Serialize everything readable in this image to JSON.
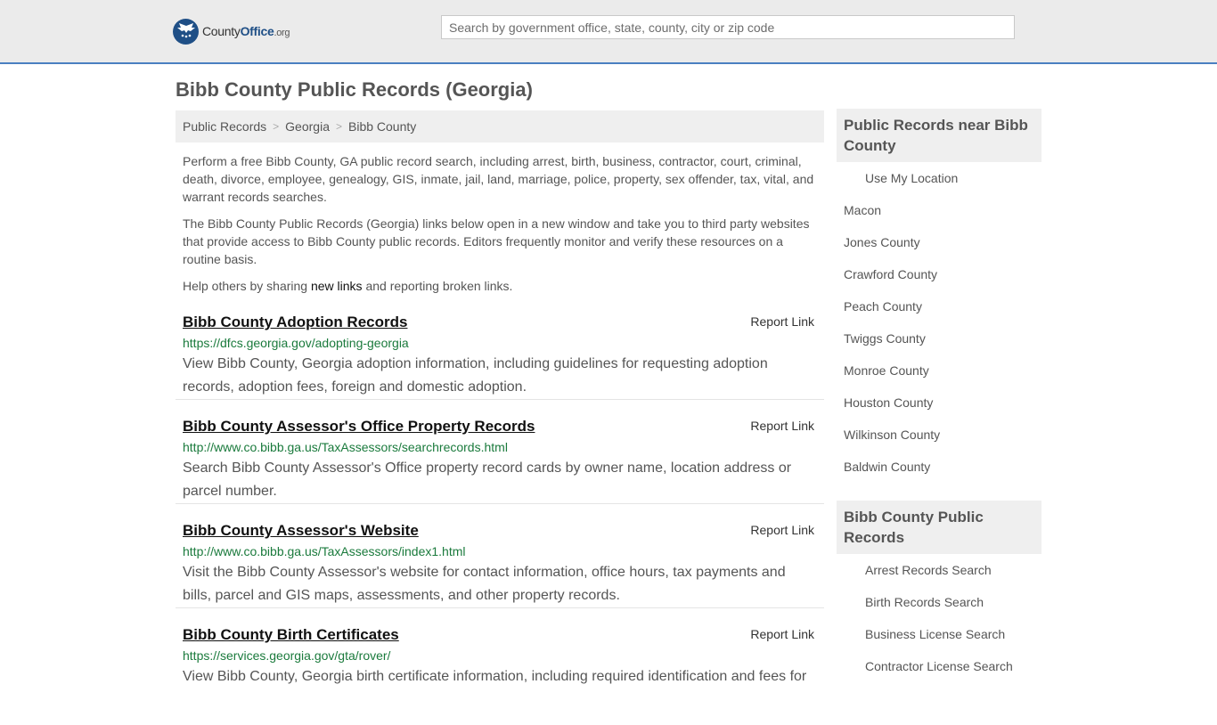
{
  "header": {
    "logo": {
      "county": "County",
      "office": "Office",
      "tld": ".org"
    },
    "search_placeholder": "Search by government office, state, county, city or zip code"
  },
  "page_title": "Bibb County Public Records (Georgia)",
  "breadcrumb": [
    "Public Records",
    "Georgia",
    "Bibb County"
  ],
  "intro": {
    "p1": "Perform a free Bibb County, GA public record search, including arrest, birth, business, contractor, court, criminal, death, divorce, employee, genealogy, GIS, inmate, jail, land, marriage, police, property, sex offender, tax, vital, and warrant records searches.",
    "p2": "The Bibb County Public Records (Georgia) links below open in a new window and take you to third party websites that provide access to Bibb County public records. Editors frequently monitor and verify these resources on a routine basis.",
    "p3_before": "Help others by sharing ",
    "p3_link": "new links",
    "p3_after": " and reporting broken links."
  },
  "report_link_label": "Report Link",
  "records": [
    {
      "title": "Bibb County Adoption Records",
      "url": "https://dfcs.georgia.gov/adopting-georgia",
      "description": "View Bibb County, Georgia adoption information, including guidelines for requesting adoption records, adoption fees, foreign and domestic adoption."
    },
    {
      "title": "Bibb County Assessor's Office Property Records",
      "url": "http://www.co.bibb.ga.us/TaxAssessors/searchrecords.html",
      "description": "Search Bibb County Assessor's Office property record cards by owner name, location address or parcel number."
    },
    {
      "title": "Bibb County Assessor's Website",
      "url": "http://www.co.bibb.ga.us/TaxAssessors/index1.html",
      "description": "Visit the Bibb County Assessor's website for contact information, office hours, tax payments and bills, parcel and GIS maps, assessments, and other property records."
    },
    {
      "title": "Bibb County Birth Certificates",
      "url": "https://services.georgia.gov/gta/rover/",
      "description": "View Bibb County, Georgia birth certificate information, including required identification and fees for"
    }
  ],
  "sidebar": {
    "nearby_heading": "Public Records near Bibb County",
    "use_location": "Use My Location",
    "nearby": [
      "Macon",
      "Jones County",
      "Crawford County",
      "Peach County",
      "Twiggs County",
      "Monroe County",
      "Houston County",
      "Wilkinson County",
      "Baldwin County"
    ],
    "county_heading": "Bibb County Public Records",
    "county_links": [
      "Arrest Records Search",
      "Birth Records Search",
      "Business License Search",
      "Contractor License Search"
    ]
  },
  "colors": {
    "accent_blue": "#4a7fc1",
    "url_green": "#1a7a3c",
    "logo_navy": "#1f4f86"
  }
}
